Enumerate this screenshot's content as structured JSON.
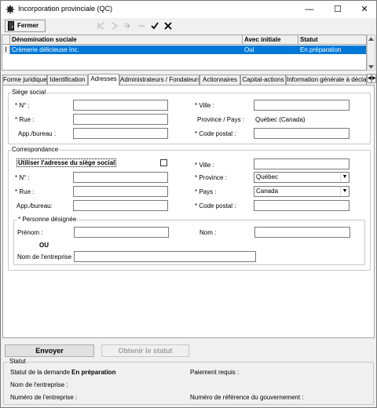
{
  "window": {
    "title": "Incorporation provinciale (QC)",
    "controls": {
      "minimize": "—",
      "maximize": "☐",
      "close": "✕"
    }
  },
  "toolbar": {
    "close_label": "Fermer",
    "icons": [
      "first-icon",
      "prev-icon",
      "next-icon",
      "last-icon",
      "check-icon",
      "cancel-icon"
    ]
  },
  "grid": {
    "columns": [
      "Dénomination sociale",
      "Avec initiale",
      "Statut"
    ],
    "rows": [
      {
        "indicator": "I",
        "name": "Crèmerie délicieuse Inc.",
        "initial": "Oui",
        "status": "En préparation"
      }
    ]
  },
  "tabs": [
    "Forme juridique",
    "Identification",
    "Adresses",
    "Administrateurs / Fondateurs",
    "Actionnaires",
    "Capital-actions",
    "Information générale à déclarer"
  ],
  "active_tab": "Adresses",
  "siege": {
    "legend": "Siège social",
    "no_label": "* N° :",
    "rue_label": "* Rue :",
    "app_label": "App./bureau :",
    "ville_label": "* Ville :",
    "province_label": "Province / Pays :",
    "province_value": "Québec (Canada)",
    "postal_label": "* Code postal :",
    "no_value": "",
    "rue_value": "",
    "app_value": "",
    "ville_value": "",
    "postal_value": ""
  },
  "corr": {
    "legend": "Correspondance",
    "use_siege_label": "Utiliser l'adresse du siège social",
    "use_siege_checked": false,
    "no_label": "* N° :",
    "rue_label": "* Rue :",
    "app_label": "App./bureau:",
    "ville_label": "* Ville :",
    "province_label": "* Province :",
    "province_value": "Québec",
    "pays_label": "* Pays :",
    "pays_value": "Canada",
    "postal_label": "* Code postal :",
    "person": {
      "legend": "* Personne désignée",
      "prenom_label": "Prénom :",
      "nom_label": "Nom :",
      "or_label": "OU",
      "entreprise_label": "Nom de l'entreprise :"
    }
  },
  "actions": {
    "send": "Envoyer",
    "get_status": "Obtenir le statut"
  },
  "status": {
    "legend": "Statut",
    "request_label": "Statut de la demande :",
    "request_value": "En préparation",
    "payment_label": "Paiement requis :",
    "company_name_label": "Nom de l'entreprise :",
    "company_no_label": "Numéro de l'entreprise :",
    "gov_ref_label": "Numéro de référence du gouvernement :"
  }
}
